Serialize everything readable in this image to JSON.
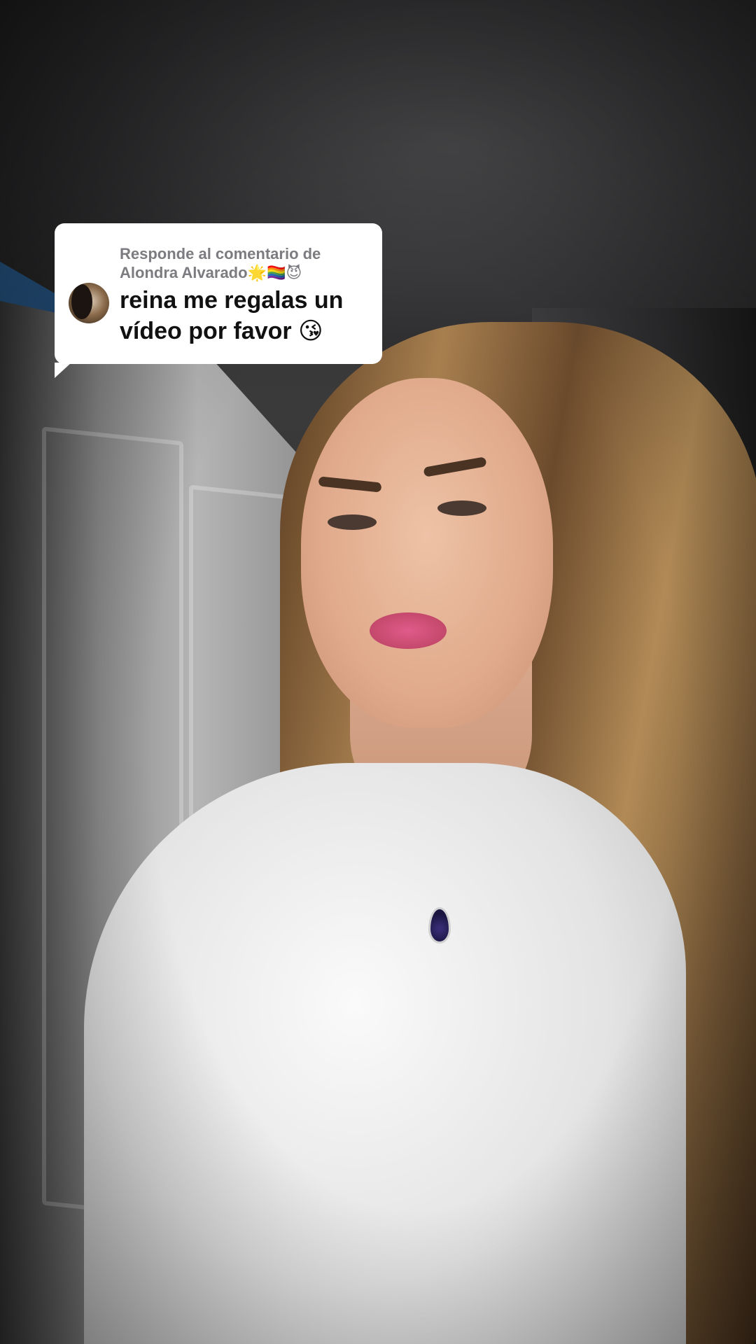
{
  "reply": {
    "header_line1": "Responde al comentario de",
    "header_name": "Alondra Alvarado",
    "header_emojis": "🌟🏳️‍🌈😈",
    "comment_line1": "reina me regalas un",
    "comment_line2": "vídeo por favor",
    "comment_emoji": "😘"
  },
  "icons": {
    "avatar": "commenter-avatar",
    "pendant": "necklace-pendant"
  },
  "colors": {
    "bubble_bg": "#ffffff",
    "header_text": "#7c7c80",
    "comment_text": "#111111"
  }
}
